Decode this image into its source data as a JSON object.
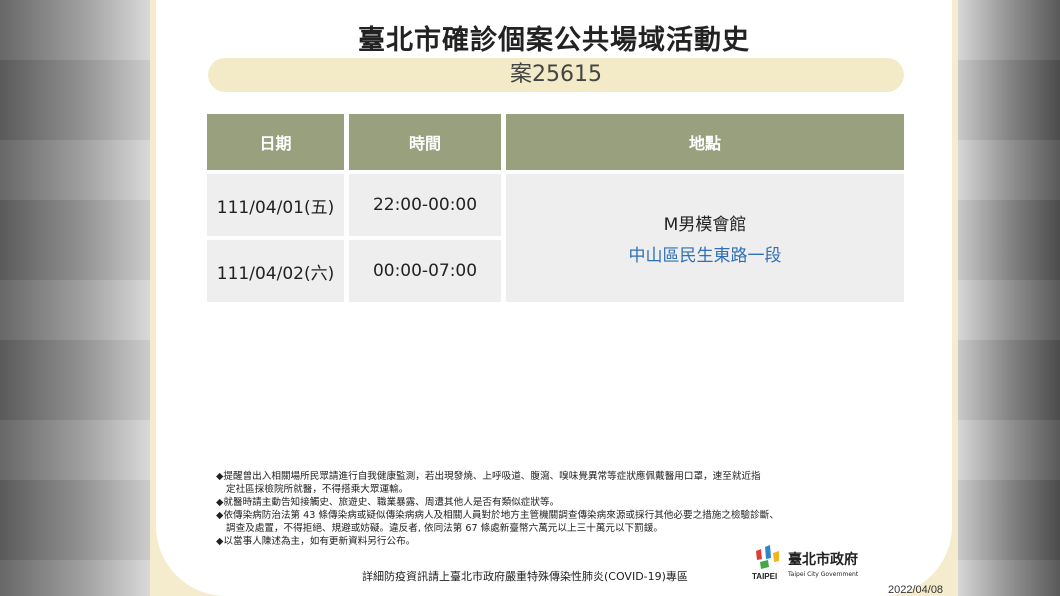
{
  "title": "臺北市確診個案公共場域活動史",
  "case_label": "案25615",
  "table": {
    "headers": {
      "date": "日期",
      "time": "時間",
      "place": "地點"
    },
    "rows": [
      {
        "date": "111/04/01(五)",
        "time": "22:00-00:00"
      },
      {
        "date": "111/04/02(六)",
        "time": "00:00-07:00"
      }
    ],
    "location": {
      "name": "M男模會館",
      "address": "中山區民生東路一段"
    }
  },
  "notes": [
    "◆提醒曾出入相關場所民眾請進行自我健康監測，若出現發燒、上呼吸道、腹瀉、嗅味覺異常等症狀應佩戴醫用口罩，速至就近指",
    "定社區採檢院所就醫，不得搭乘大眾運輸。",
    "◆就醫時請主動告知接觸史、旅遊史、職業暴露、周遭其他人是否有類似症狀等。",
    "◆依傳染病防治法第 43 條傳染病或疑似傳染病病人及相關人員對於地方主管機關調查傳染病來源或採行其他必要之措施之檢驗診斷、",
    "調查及處置，不得拒絕、規避或妨礙。違反者, 依同法第 67 條處新臺幣六萬元以上三十萬元以下罰鍰。",
    "◆以當事人陳述為主，如有更新資料另行公布。"
  ],
  "footer": "詳細防疫資訊請上臺北市政府嚴重特殊傳染性肺炎(COVID-19)專區",
  "logo": {
    "cn": "臺北市政府",
    "en_brand": "TAIPEI",
    "en_sub": "Taipei City Government"
  },
  "date_stamp": "2022/04/08",
  "colors": {
    "header_bg": "#98a07e",
    "case_bar_bg": "#f3ebc8",
    "address_blue": "#2f6fb5"
  }
}
